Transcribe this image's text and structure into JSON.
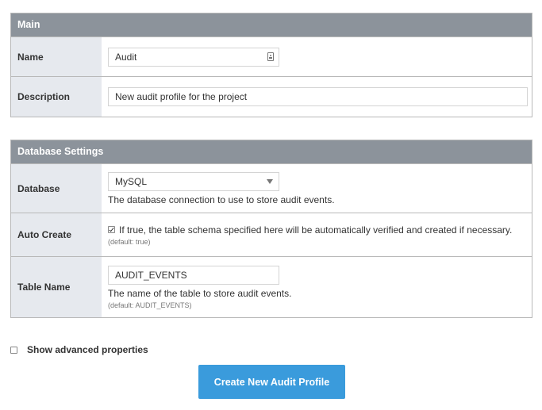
{
  "main_section": {
    "title": "Main",
    "name_label": "Name",
    "name_value": "Audit",
    "description_label": "Description",
    "description_value": "New audit profile for the project"
  },
  "database_section": {
    "title": "Database Settings",
    "database_label": "Database",
    "database_selected": "MySQL",
    "database_help": "The database connection to use to store audit events.",
    "auto_create_label": "Auto Create",
    "auto_create_checked": true,
    "auto_create_help": "If true, the table schema specified here will be automatically verified and created if necessary.",
    "auto_create_default": "(default: true)",
    "table_name_label": "Table Name",
    "table_name_value": "AUDIT_EVENTS",
    "table_name_help": "The name of the table to store audit events.",
    "table_name_default": "(default: AUDIT_EVENTS)"
  },
  "advanced": {
    "label": "Show advanced properties",
    "checked": false
  },
  "submit": {
    "label": "Create New Audit Profile"
  },
  "colors": {
    "header_bg": "#8c939b",
    "label_bg": "#e6e9ee",
    "button_bg": "#3a9bdc",
    "border": "#b9b9b9"
  }
}
